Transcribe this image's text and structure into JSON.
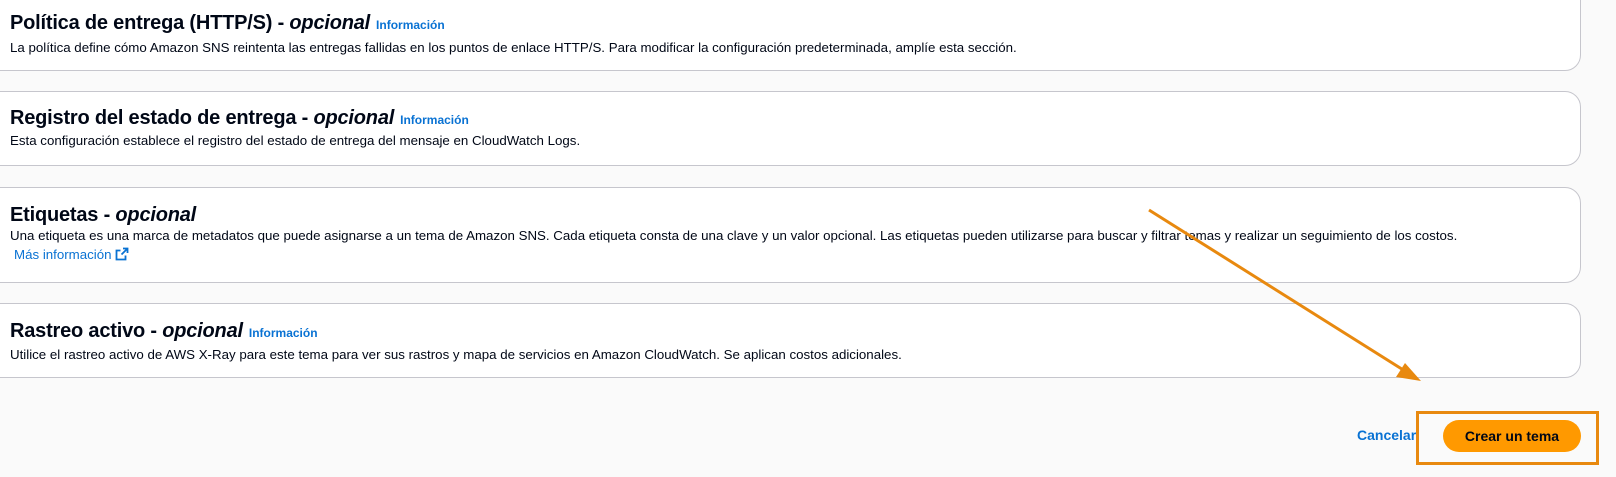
{
  "colors": {
    "link": "#0972d3",
    "primary_button": "#ff9900",
    "annotation": "#e8890f",
    "panel_border": "#c6c6cd",
    "page_background": "#fafafa"
  },
  "sections": [
    {
      "title": "Política de entrega (HTTP/S) - ",
      "optional": "opcional",
      "info": "Información",
      "description": "La política define cómo Amazon SNS reintenta las entregas fallidas en los puntos de enlace HTTP/S. Para modificar la configuración predeterminada, amplíe esta sección."
    },
    {
      "title": "Registro del estado de entrega - ",
      "optional": "opcional",
      "info": "Información",
      "description": "Esta configuración establece el registro del estado de entrega del mensaje en CloudWatch Logs."
    },
    {
      "title": "Etiquetas - ",
      "optional": "opcional",
      "description": "Una etiqueta es una marca de metadatos que puede asignarse a un tema de Amazon SNS. Cada etiqueta consta de una clave y un valor opcional. Las etiquetas pueden utilizarse para buscar y filtrar temas y realizar un seguimiento de los costos.",
      "link": "Más información",
      "link_icon": "external-link-icon"
    },
    {
      "title": "Rastreo activo - ",
      "optional": "opcional",
      "info": "Información",
      "description": "Utilice el rastreo activo de AWS X-Ray para este tema para ver sus rastros y mapa de servicios en Amazon CloudWatch. Se aplican costos adicionales."
    }
  ],
  "actions": {
    "cancel": "Cancelar",
    "create": "Crear un tema"
  }
}
